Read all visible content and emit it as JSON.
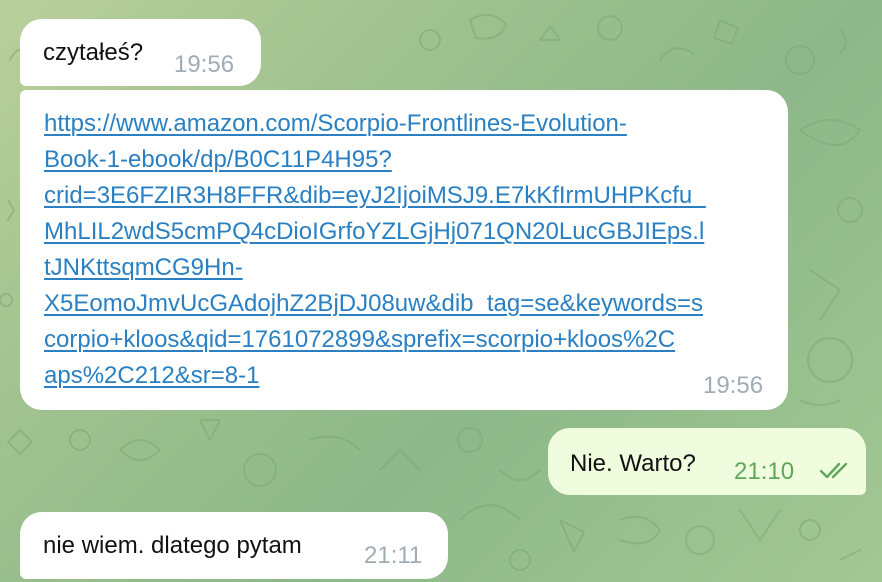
{
  "chat": {
    "messages": [
      {
        "direction": "incoming",
        "text": "czytałeś?",
        "time": "19:56"
      },
      {
        "direction": "incoming",
        "link_lines": [
          "https://www.amazon.com/Scorpio-Frontlines-Evolution-",
          "Book-1-ebook/dp/B0C11P4H95?",
          "crid=3E6FZIR3H8FFR&dib=eyJ2IjoiMSJ9.E7kKfIrmUHPKcfu_",
          "MhLIL2wdS5cmPQ4cDioIGrfoYZLGjHj071QN20LucGBJIEps.l",
          "tJNKttsqmCG9Hn-",
          "X5EomoJmvUcGAdojhZ2BjDJ08uw&dib_tag=se&keywords=s",
          "corpio+kloos&qid=1761072899&sprefix=scorpio+kloos%2C",
          "aps%2C212&sr=8-1"
        ],
        "time": "19:56"
      },
      {
        "direction": "outgoing",
        "text": "Nie. Warto?",
        "time": "21:10",
        "status_icon": "double-check-icon"
      },
      {
        "direction": "incoming",
        "text": "nie wiem. dlatego pytam",
        "time": "21:11"
      }
    ]
  },
  "colors": {
    "incoming_bubble": "#ffffff",
    "outgoing_bubble": "#effdde",
    "link": "#2a80c2",
    "time_incoming": "#a0acb6",
    "time_outgoing": "#5fa75a",
    "background": "#9cc08e"
  }
}
